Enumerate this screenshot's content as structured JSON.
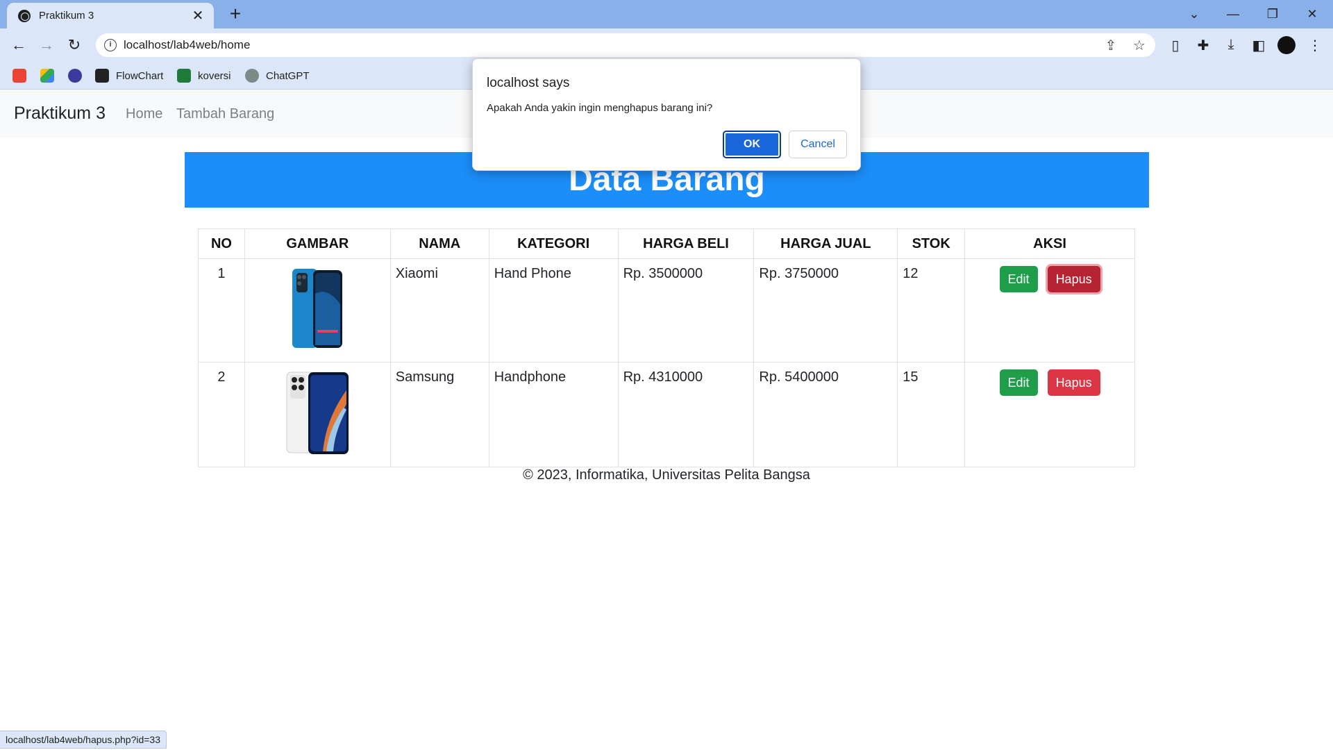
{
  "browser": {
    "tab_title": "Praktikum 3",
    "tab_close": "✕",
    "new_tab": "+",
    "window_controls": {
      "tab_search": "⌄",
      "minimize": "—",
      "restore": "❐",
      "close": "✕"
    },
    "url": "localhost/lab4web/home",
    "bookmarks": [
      {
        "label": "",
        "icon": "gmail-icon"
      },
      {
        "label": "",
        "icon": "drive-icon"
      },
      {
        "label": "",
        "icon": "app-icon"
      },
      {
        "label": "FlowChart",
        "icon": "flowchart-icon"
      },
      {
        "label": "koversi",
        "icon": "koversi-icon"
      },
      {
        "label": "ChatGPT",
        "icon": "chatgpt-icon"
      }
    ],
    "status_url": "localhost/lab4web/hapus.php?id=33"
  },
  "navbar": {
    "brand": "Praktikum 3",
    "links": [
      "Home",
      "Tambah Barang"
    ]
  },
  "banner": {
    "title": "Data Barang"
  },
  "table": {
    "headers": [
      "NO",
      "GAMBAR",
      "NAMA",
      "KATEGORI",
      "HARGA BELI",
      "HARGA JUAL",
      "STOK",
      "AKSI"
    ],
    "rows": [
      {
        "no": "1",
        "nama": "Xiaomi",
        "kategori": "Hand Phone",
        "harga_beli": "Rp. 3500000",
        "harga_jual": "Rp. 3750000",
        "stok": "12",
        "edit": "Edit",
        "hapus": "Hapus"
      },
      {
        "no": "2",
        "nama": "Samsung",
        "kategori": "Handphone",
        "harga_beli": "Rp. 4310000",
        "harga_jual": "Rp. 5400000",
        "stok": "15",
        "edit": "Edit",
        "hapus": "Hapus"
      }
    ]
  },
  "footer": "© 2023, Informatika, Universitas Pelita Bangsa",
  "dialog": {
    "title": "localhost says",
    "message": "Apakah Anda yakin ingin menghapus barang ini?",
    "ok": "OK",
    "cancel": "Cancel"
  },
  "colors": {
    "banner": "#1c8ef9",
    "edit_button": "#1e9e4a",
    "hapus_button": "#dc3545",
    "dialog_ok": "#1a66db"
  }
}
